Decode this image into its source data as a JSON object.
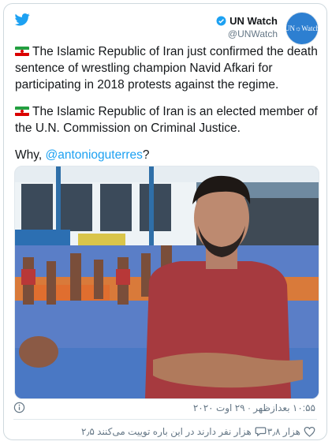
{
  "account": {
    "name": "UN Watch",
    "handle": "@UNWatch",
    "avatar_text": "UN☼Watch"
  },
  "tweet": {
    "p1_text": "The Islamic Republic of Iran just confirmed the death sentence of wrestling champion Navid Afkari for participating in 2018 protests against the regime.",
    "p2_text": "The Islamic Republic of Iran is an elected member of the U.N. Commission on Criminal Justice.",
    "p3_prefix": "Why, ",
    "p3_mention": "@antonioguterres",
    "p3_suffix": "?",
    "flag_icon": "iran-flag-emoji"
  },
  "meta": {
    "timestamp": "۱۰:۵۵ بعدازظهر · ۲۹ اوت ۲۰۲۰"
  },
  "actions": {
    "likes": "۳٫۸ هزار",
    "replies": "۲٫۵ هزار نفر دارند در این باره توییت می‌کنند"
  },
  "colors": {
    "accent": "#1da1f2",
    "text": "#14171a",
    "muted": "#657786"
  }
}
